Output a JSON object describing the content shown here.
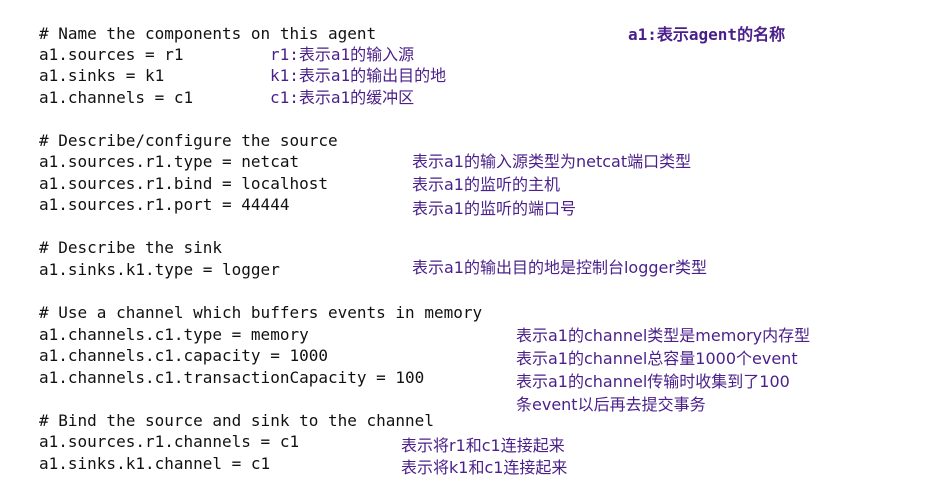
{
  "code_lines": {
    "l1": "# Name the components on this agent",
    "l2": "a1.sources = r1",
    "l3": "a1.sinks = k1",
    "l4": "a1.channels = c1",
    "l5": "# Describe/configure the source",
    "l6": "a1.sources.r1.type = netcat",
    "l7": "a1.sources.r1.bind = localhost",
    "l8": "a1.sources.r1.port = 44444",
    "l9": "# Describe the sink",
    "l10": "a1.sinks.k1.type = logger",
    "l11": "# Use a channel which buffers events in memory",
    "l12": "a1.channels.c1.type = memory",
    "l13": "a1.channels.c1.capacity = 1000",
    "l14": "a1.channels.c1.transactionCapacity = 100",
    "l15": "# Bind the source and sink to the channel",
    "l16": "a1.sources.r1.channels = c1",
    "l17": "a1.sinks.k1.channel = c1"
  },
  "annotations": {
    "agent_name": "a1:表示agent的名称",
    "r1": "r1:表示a1的输入源",
    "k1": "k1:表示a1的输出目的地",
    "c1": "c1:表示a1的缓冲区",
    "source_type": "表示a1的输入源类型为netcat端口类型",
    "source_bind": "表示a1的监听的主机",
    "source_port": "表示a1的监听的端口号",
    "sink_type": "表示a1的输出目的地是控制台logger类型",
    "channel_type": "表示a1的channel类型是memory内存型",
    "channel_capacity": "表示a1的channel总容量1000个event",
    "channel_txn_1": "表示a1的channel传输时收集到了100",
    "channel_txn_2": "条event以后再去提交事务",
    "bind_source": "表示将r1和c1连接起来",
    "bind_sink": "表示将k1和c1连接起来"
  },
  "colors": {
    "code": "#111111",
    "annotation": "#4a1f8a"
  }
}
